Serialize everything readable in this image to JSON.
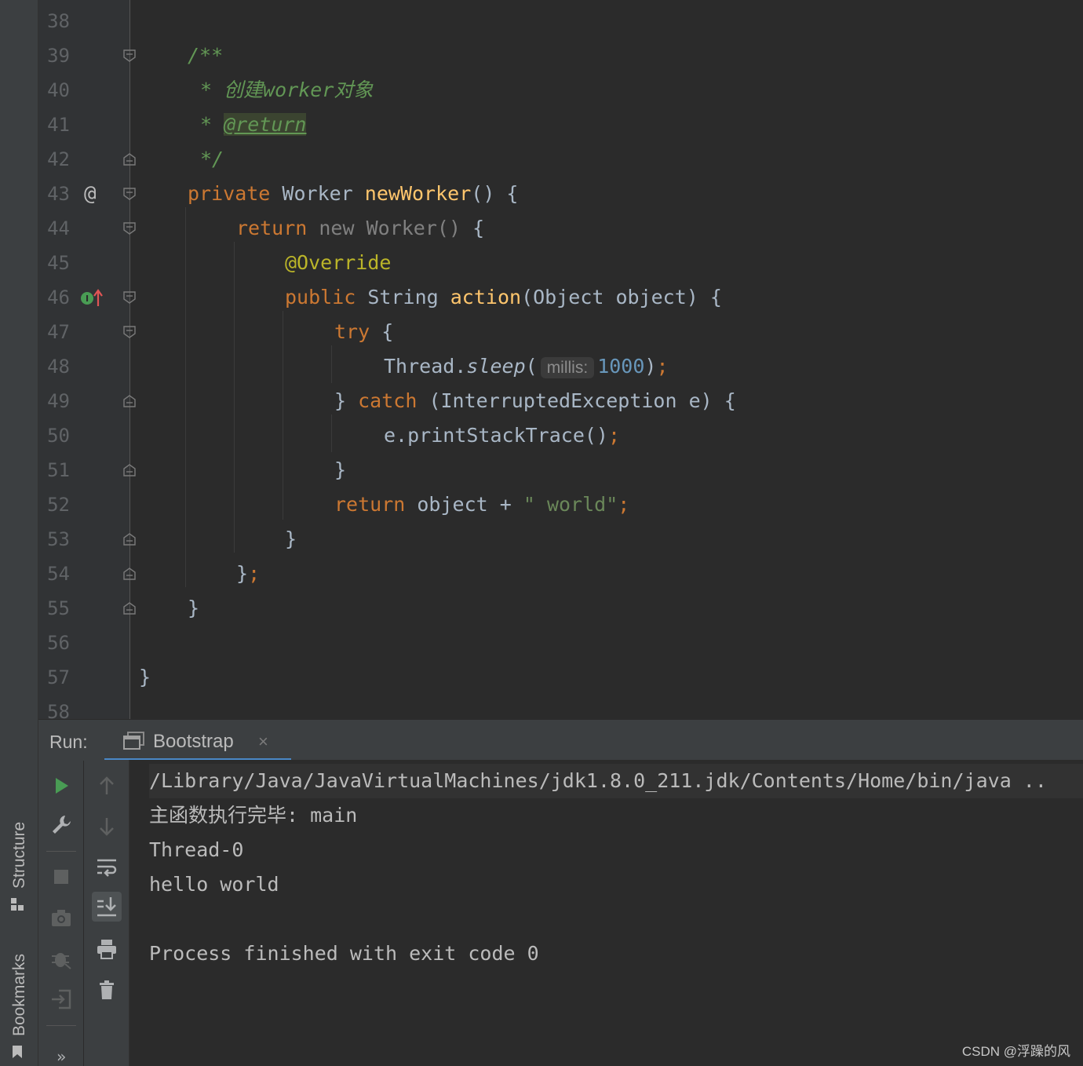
{
  "sidebar": {
    "tabs": [
      {
        "label": "Structure",
        "icon": "structure-icon"
      },
      {
        "label": "Bookmarks",
        "icon": "bookmark-icon"
      }
    ]
  },
  "editor": {
    "lines": [
      {
        "n": "38"
      },
      {
        "n": "39",
        "comment_open": "/**"
      },
      {
        "n": "40",
        "comment_text": "* 创建worker对象"
      },
      {
        "n": "41",
        "comment_star": "* ",
        "comment_tag": "@return"
      },
      {
        "n": "42",
        "comment_close": "*/"
      },
      {
        "n": "43",
        "marker": "@",
        "kw": "private",
        "type": "Worker",
        "method": "newWorker",
        "tail": "() {"
      },
      {
        "n": "44",
        "kw": "return",
        "anon_new": "new",
        "anon_type": "Worker()",
        "tail": "{"
      },
      {
        "n": "45",
        "annotation": "@Override"
      },
      {
        "n": "46",
        "kw": "public",
        "type": "String",
        "method": "action",
        "tail": "(Object object) {"
      },
      {
        "n": "47",
        "kw": "try",
        "tail": "{"
      },
      {
        "n": "48",
        "cls": "Thread.",
        "call": "sleep",
        "paren": "(",
        "hint": "millis:",
        "num": "1000",
        "close": ")",
        "semi": ";"
      },
      {
        "n": "49",
        "pre": "}",
        "kw": "catch",
        "tail": "(InterruptedException e) {"
      },
      {
        "n": "50",
        "text": "e.printStackTrace()",
        "semi": ";"
      },
      {
        "n": "51",
        "text": "}"
      },
      {
        "n": "52",
        "kw": "return",
        "text": "object + ",
        "str": "\" world\"",
        "semi": ";"
      },
      {
        "n": "53",
        "text": "}"
      },
      {
        "n": "54",
        "text": "}",
        "semi": ";"
      },
      {
        "n": "55",
        "text": "}"
      },
      {
        "n": "56"
      },
      {
        "n": "57",
        "text": "}"
      },
      {
        "n": "58"
      }
    ]
  },
  "run_panel": {
    "label": "Run:",
    "tab": {
      "label": "Bootstrap",
      "icon": "console-window-icon",
      "close": "×"
    },
    "console": [
      "/Library/Java/JavaVirtualMachines/jdk1.8.0_211.jdk/Contents/Home/bin/java ..",
      "主函数执行完毕: main",
      "Thread-0",
      "hello world",
      "",
      "Process finished with exit code 0"
    ],
    "more": "»"
  },
  "watermark": "CSDN @浮躁的风",
  "colors": {
    "background": "#2b2b2b",
    "keyword": "#cc7832",
    "method": "#ffc66d",
    "comment": "#629755",
    "number": "#6897bb",
    "string": "#6a8759",
    "accent": "#4a88c7"
  }
}
